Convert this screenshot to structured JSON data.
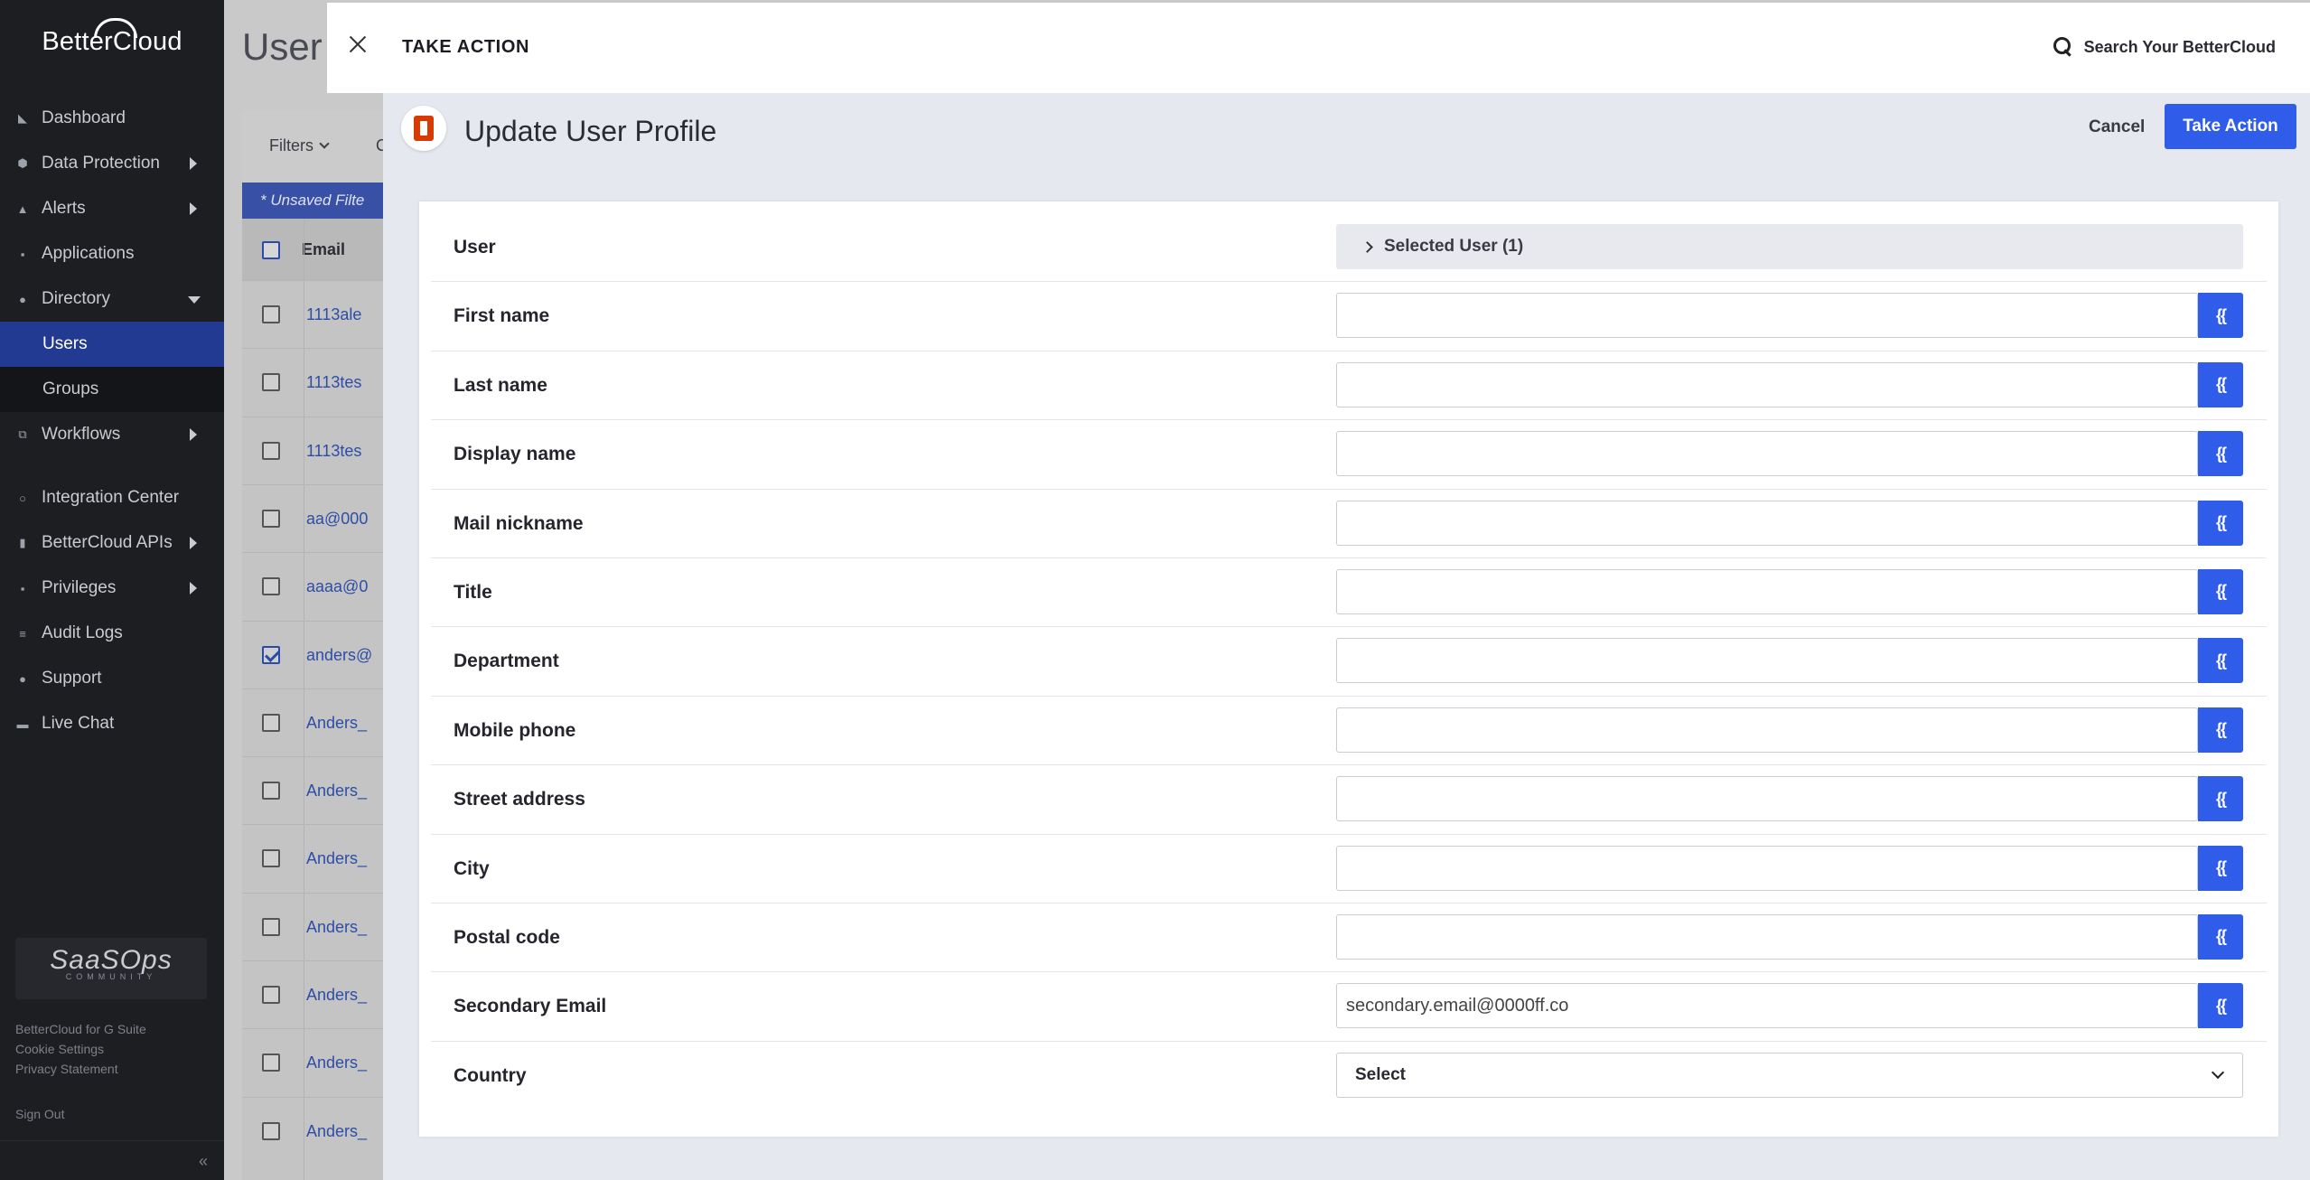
{
  "sidebar": {
    "brand": "BetterCloud",
    "items": [
      {
        "label": "Dashboard",
        "icon": "dashboard-icon",
        "caret": false
      },
      {
        "label": "Data Protection",
        "icon": "shield-icon",
        "caret": true
      },
      {
        "label": "Alerts",
        "icon": "bell-icon",
        "caret": true
      },
      {
        "label": "Applications",
        "icon": "apps-grid-icon",
        "caret": false
      },
      {
        "label": "Directory",
        "icon": "people-icon",
        "caret": "down"
      }
    ],
    "sub_items": [
      "Users",
      "Groups"
    ],
    "items2": [
      {
        "label": "Workflows",
        "icon": "workflow-icon",
        "caret": true
      }
    ],
    "items3": [
      {
        "label": "Integration Center",
        "icon": "integration-icon",
        "caret": false
      },
      {
        "label": "BetterCloud APIs",
        "icon": "bar-chart-icon",
        "caret": true
      },
      {
        "label": "Privileges",
        "icon": "privileges-icon",
        "caret": true
      },
      {
        "label": "Audit Logs",
        "icon": "log-icon",
        "caret": false
      },
      {
        "label": "Support",
        "icon": "support-icon",
        "caret": false
      },
      {
        "label": "Live Chat",
        "icon": "chat-icon",
        "caret": false
      }
    ],
    "community_big": "SaaSOps",
    "community_small": "COMMUNITY",
    "footer_links": [
      "BetterCloud for G Suite",
      "Cookie Settings",
      "Privacy Statement"
    ],
    "sign_out": "Sign Out",
    "collapse": "«"
  },
  "background": {
    "title": "User",
    "filters": "Filters",
    "c_stub": "C",
    "unsaved": "* Unsaved Filte",
    "email_header": "Email",
    "rows": [
      "1113ale",
      "1113tes",
      "1113tes",
      "aa@000",
      "aaaa@0",
      "anders@",
      "Anders_",
      "Anders_",
      "Anders_",
      "Anders_",
      "Anders_",
      "Anders_",
      "Anders_"
    ],
    "checked_index": 5
  },
  "modal": {
    "title": "TAKE ACTION",
    "search": "Search Your BetterCloud",
    "action_title": "Update User Profile",
    "cancel": "Cancel",
    "take_action": "Take Action",
    "user_label": "User",
    "selected_user": "Selected User (1)",
    "variable_glyph": "{{",
    "fields": [
      {
        "label": "First name",
        "value": ""
      },
      {
        "label": "Last name",
        "value": ""
      },
      {
        "label": "Display name",
        "value": ""
      },
      {
        "label": "Mail nickname",
        "value": ""
      },
      {
        "label": "Title",
        "value": ""
      },
      {
        "label": "Department",
        "value": ""
      },
      {
        "label": "Mobile phone",
        "value": ""
      },
      {
        "label": "Street address",
        "value": ""
      },
      {
        "label": "City",
        "value": ""
      },
      {
        "label": "Postal code",
        "value": ""
      },
      {
        "label": "Secondary Email",
        "value": "secondary.email@0000ff.co"
      }
    ],
    "country_label": "Country",
    "country_value": "Select"
  },
  "colors": {
    "accent": "#2f5ce8",
    "sidebar_bg": "#1d1e22",
    "active_nav": "#233a93",
    "office_icon": "#d83b01"
  }
}
